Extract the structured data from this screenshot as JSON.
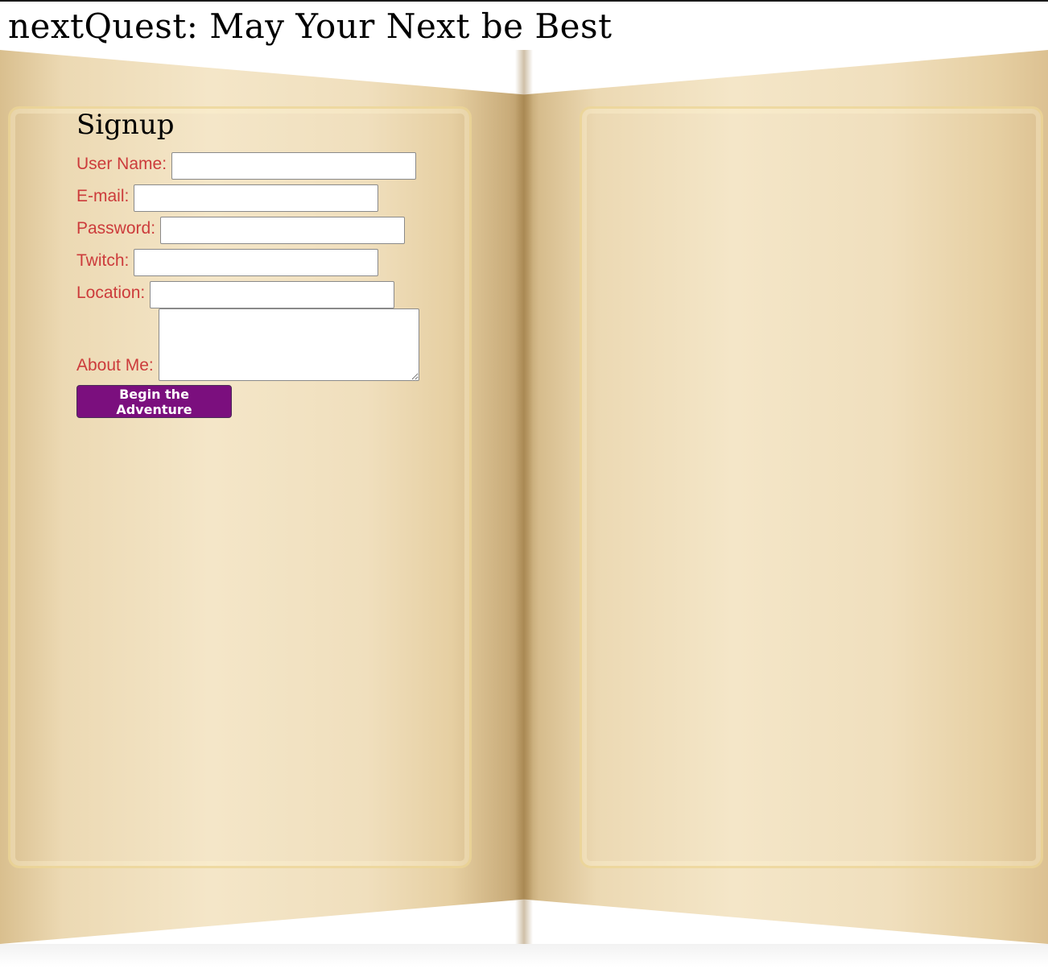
{
  "header": {
    "title": "nextQuest: May Your Next be Best"
  },
  "signup": {
    "heading": "Signup",
    "fields": {
      "username_label": "User Name:",
      "email_label": "E-mail:",
      "password_label": "Password:",
      "twitch_label": "Twitch:",
      "location_label": "Location:",
      "about_label": "About Me:"
    },
    "values": {
      "username": "",
      "email": "",
      "password": "",
      "twitch": "",
      "location": "",
      "about": ""
    },
    "submit_label": "Begin the Adventure"
  },
  "colors": {
    "label": "#cc3b3b",
    "button_bg": "#7b0f7e",
    "button_text": "#ffffff",
    "page_parchment": "#f4e6c8"
  }
}
